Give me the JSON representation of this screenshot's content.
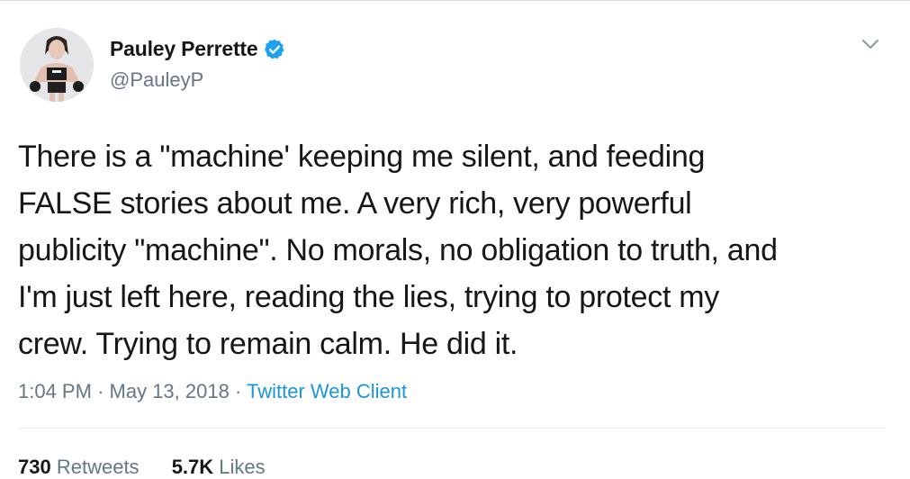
{
  "tweet": {
    "author": {
      "name": "Pauley Perrette",
      "handle": "@PauleyP",
      "verified": true,
      "avatar": "profile-photo"
    },
    "text": "There is a \"machine' keeping me silent, and feeding\nFALSE stories about me.  A very rich, very powerful\npublicity \"machine\". No morals, no obligation to truth, and\nI'm just left here, reading the lies, trying to protect my\ncrew. Trying to remain calm. He did it.",
    "time": "1:04 PM",
    "separator": "·",
    "date": "May 13, 2018",
    "source": "Twitter Web Client",
    "retweets": {
      "count": "730",
      "label": "Retweets"
    },
    "likes": {
      "count": "5.7K",
      "label": "Likes"
    }
  },
  "icons": {
    "verified": "verified-badge-icon",
    "caret": "chevron-down-icon"
  },
  "colors": {
    "link": "#1b95e0",
    "secondary_text": "#657786",
    "verified_blue": "#1da1f2"
  }
}
